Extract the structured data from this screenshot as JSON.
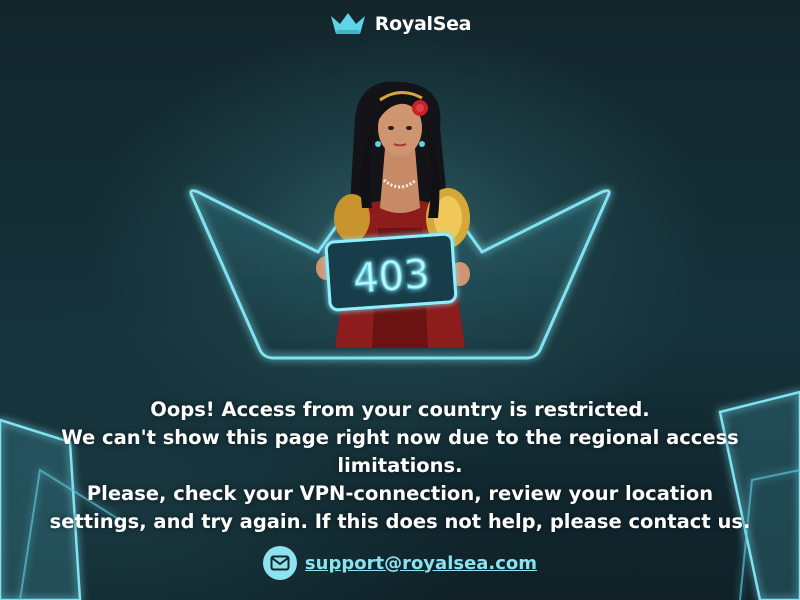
{
  "brand": {
    "name": "RoyalSea",
    "logo_icon": "crown-icon",
    "accent": "#5fd3e8"
  },
  "error": {
    "code": "403"
  },
  "message": {
    "line1": "Oops! Access from your country is restricted.",
    "line2": "We can't show this page right now due to the regional access",
    "line3": "limitations.",
    "line4": "Please, check your VPN-connection, review your location",
    "line5": "settings, and try again. If this does not help, please contact us."
  },
  "support": {
    "icon": "mail-icon",
    "email": "support@royalsea.com",
    "link_color": "#8ce2ef"
  }
}
